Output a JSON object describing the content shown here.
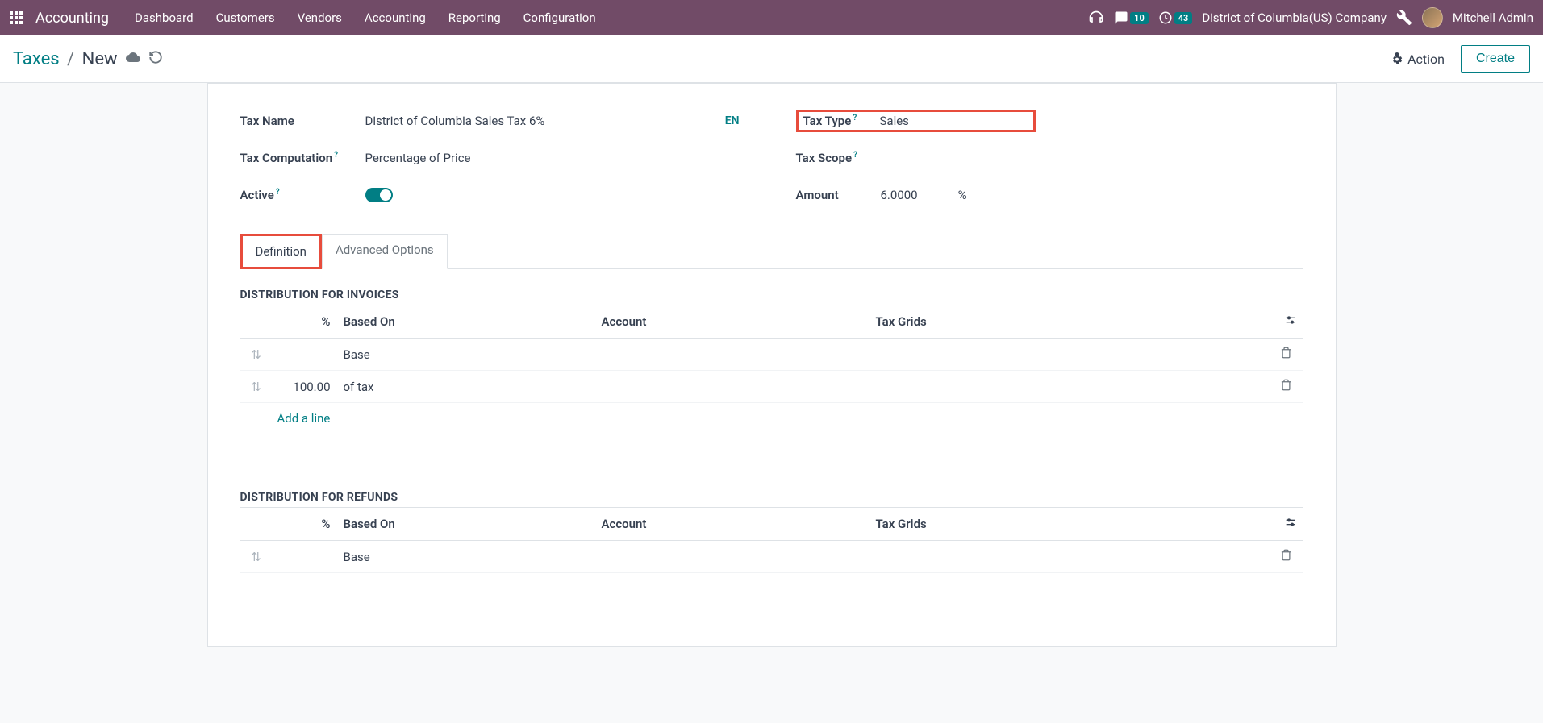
{
  "navbar": {
    "app_name": "Accounting",
    "menu": [
      "Dashboard",
      "Customers",
      "Vendors",
      "Accounting",
      "Reporting",
      "Configuration"
    ],
    "messages_count": "10",
    "activities_count": "43",
    "company": "District of Columbia(US) Company",
    "user": "Mitchell Admin"
  },
  "breadcrumb": {
    "parent": "Taxes",
    "current": "New"
  },
  "actions": {
    "action_label": "Action",
    "create_label": "Create"
  },
  "fields": {
    "tax_name_label": "Tax Name",
    "tax_name_value": "District of Columbia Sales Tax 6%",
    "lang_badge": "EN",
    "tax_type_label": "Tax Type",
    "tax_type_value": "Sales",
    "tax_computation_label": "Tax Computation",
    "tax_computation_value": "Percentage of Price",
    "tax_scope_label": "Tax Scope",
    "active_label": "Active",
    "amount_label": "Amount",
    "amount_value": "6.0000",
    "amount_unit": "%"
  },
  "tabs": {
    "definition": "Definition",
    "advanced": "Advanced Options"
  },
  "sections": {
    "invoices_title": "DISTRIBUTION FOR INVOICES",
    "refunds_title": "DISTRIBUTION FOR REFUNDS"
  },
  "table": {
    "headers": {
      "percent": "%",
      "based_on": "Based On",
      "account": "Account",
      "tax_grids": "Tax Grids"
    },
    "invoice_rows": [
      {
        "percent": "",
        "based_on": "Base"
      },
      {
        "percent": "100.00",
        "based_on": "of tax"
      }
    ],
    "refund_rows": [
      {
        "percent": "",
        "based_on": "Base"
      }
    ],
    "add_line": "Add a line"
  }
}
